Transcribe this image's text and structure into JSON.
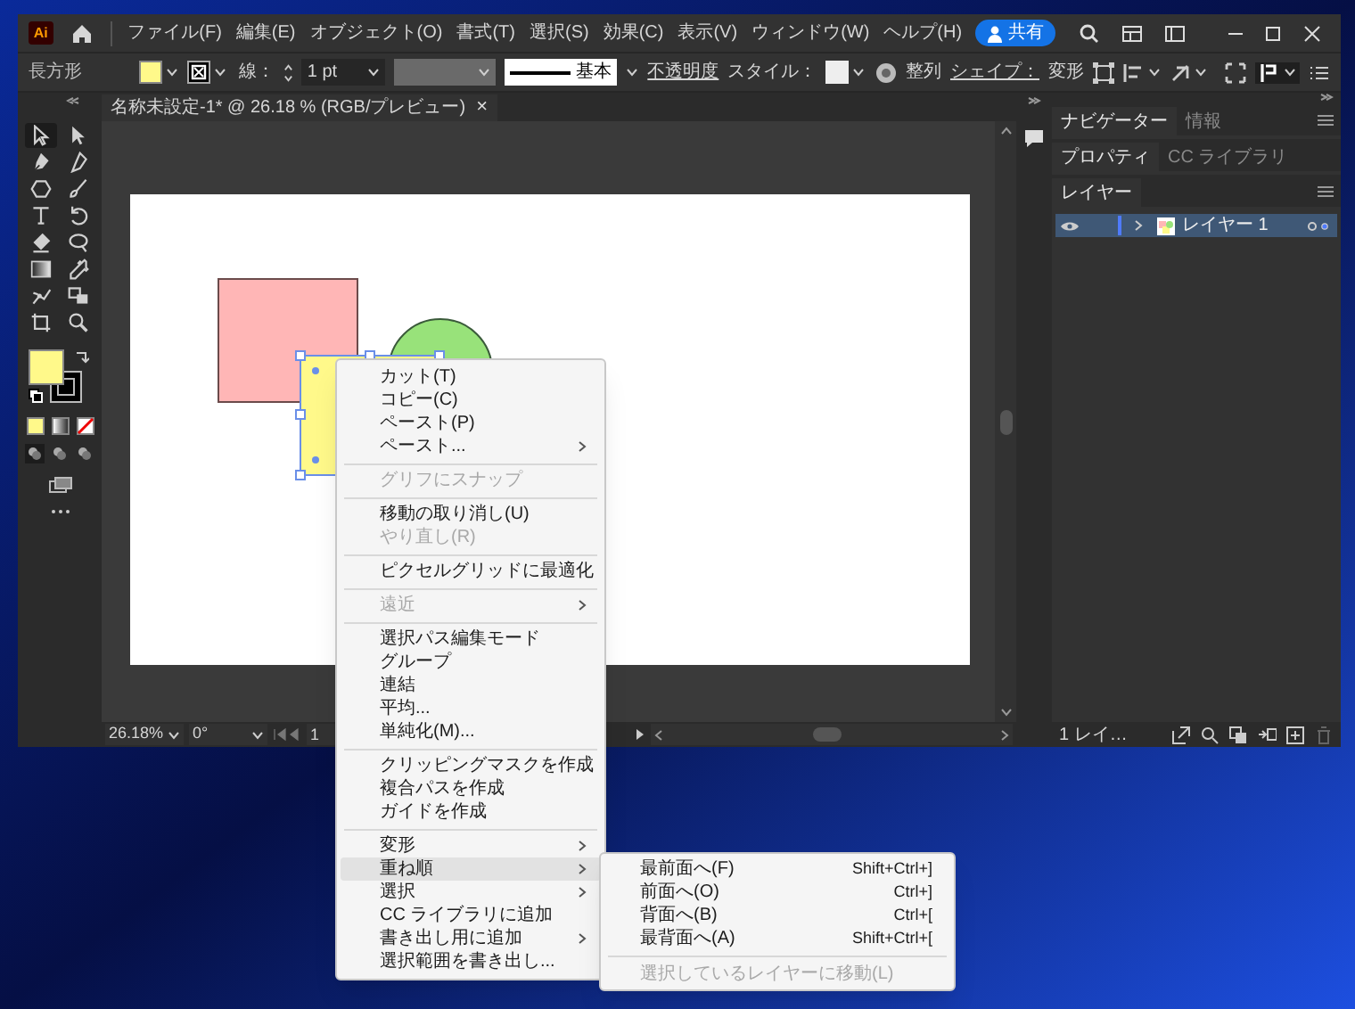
{
  "app": {
    "logo": "Ai"
  },
  "menu_bar": [
    "ファイル(F)",
    "編集(E)",
    "オブジェクト(O)",
    "書式(T)",
    "選択(S)",
    "効果(C)",
    "表示(V)",
    "ウィンドウ(W)",
    "ヘルプ(H)"
  ],
  "share_button": {
    "label": "共有"
  },
  "control_bar": {
    "object_type": "長方形",
    "stroke_label": "線：",
    "stroke_weight": "1 pt",
    "brush": "基本",
    "opacity_link": "不透明度",
    "style_label": "スタイル：",
    "align": "整列",
    "shape_label": "シェイプ：",
    "transform": "変形"
  },
  "tools": [
    {
      "selected": true
    },
    {
      "selected": false
    },
    {
      "selected": false
    },
    {
      "selected": false
    },
    {
      "selected": false
    },
    {
      "selected": false
    },
    {
      "selected": false
    },
    {
      "selected": false
    },
    {
      "selected": false
    },
    {
      "selected": false
    },
    {
      "selected": false
    },
    {
      "selected": false
    },
    {
      "selected": false
    },
    {
      "selected": false
    },
    {
      "selected": false
    },
    {
      "selected": false
    }
  ],
  "document_tab": {
    "title": "名称未設定-1* @ 26.18 % (RGB/プレビュー)",
    "close": "×"
  },
  "status_bar": {
    "zoom": "26.18%",
    "rotation": "0°",
    "artboard": "1"
  },
  "panels": {
    "tab_groups": [
      {
        "tabs": [
          {
            "label": "ナビゲーター",
            "selected": true
          },
          {
            "label": "情報",
            "selected": false
          }
        ]
      },
      {
        "tabs": [
          {
            "label": "プロパティ",
            "selected": true
          },
          {
            "label": "CC ライブラリ",
            "selected": false
          }
        ]
      },
      {
        "tabs": [
          {
            "label": "レイヤー",
            "selected": true
          }
        ]
      }
    ],
    "layers": [
      {
        "name": "レイヤー 1",
        "selected": true,
        "visible": true,
        "color": "#4f7bff"
      }
    ],
    "layer_count": "1 レイ…"
  },
  "context_menu": {
    "items": [
      {
        "kind": "item",
        "label": "カット(T)",
        "disabled": false,
        "submenu": false,
        "selected": false
      },
      {
        "kind": "item",
        "label": "コピー(C)",
        "disabled": false,
        "submenu": false,
        "selected": false
      },
      {
        "kind": "item",
        "label": "ペースト(P)",
        "disabled": false,
        "submenu": false,
        "selected": false
      },
      {
        "kind": "item",
        "label": "ペースト...",
        "disabled": false,
        "submenu": true,
        "selected": false
      },
      {
        "kind": "separator"
      },
      {
        "kind": "item",
        "label": "グリフにスナップ",
        "disabled": true,
        "submenu": false,
        "selected": false
      },
      {
        "kind": "separator"
      },
      {
        "kind": "item",
        "label": "移動の取り消し(U)",
        "disabled": false,
        "submenu": false,
        "selected": false
      },
      {
        "kind": "item",
        "label": "やり直し(R)",
        "disabled": true,
        "submenu": false,
        "selected": false
      },
      {
        "kind": "separator"
      },
      {
        "kind": "item",
        "label": "ピクセルグリッドに最適化",
        "disabled": false,
        "submenu": false,
        "selected": false
      },
      {
        "kind": "separator"
      },
      {
        "kind": "item",
        "label": "遠近",
        "disabled": true,
        "submenu": true,
        "selected": false
      },
      {
        "kind": "separator"
      },
      {
        "kind": "item",
        "label": "選択パス編集モード",
        "disabled": false,
        "submenu": false,
        "selected": false
      },
      {
        "kind": "item",
        "label": "グループ",
        "disabled": false,
        "submenu": false,
        "selected": false
      },
      {
        "kind": "item",
        "label": "連結",
        "disabled": false,
        "submenu": false,
        "selected": false
      },
      {
        "kind": "item",
        "label": "平均...",
        "disabled": false,
        "submenu": false,
        "selected": false
      },
      {
        "kind": "item",
        "label": "単純化(M)...",
        "disabled": false,
        "submenu": false,
        "selected": false
      },
      {
        "kind": "separator"
      },
      {
        "kind": "item",
        "label": "クリッピングマスクを作成",
        "disabled": false,
        "submenu": false,
        "selected": false
      },
      {
        "kind": "item",
        "label": "複合パスを作成",
        "disabled": false,
        "submenu": false,
        "selected": false
      },
      {
        "kind": "item",
        "label": "ガイドを作成",
        "disabled": false,
        "submenu": false,
        "selected": false
      },
      {
        "kind": "separator"
      },
      {
        "kind": "item",
        "label": "変形",
        "disabled": false,
        "submenu": true,
        "selected": false
      },
      {
        "kind": "item",
        "label": "重ね順",
        "disabled": false,
        "submenu": true,
        "selected": true
      },
      {
        "kind": "item",
        "label": "選択",
        "disabled": false,
        "submenu": true,
        "selected": false
      },
      {
        "kind": "item",
        "label": "CC ライブラリに追加",
        "disabled": false,
        "submenu": false,
        "selected": false
      },
      {
        "kind": "item",
        "label": "書き出し用に追加",
        "disabled": false,
        "submenu": true,
        "selected": false
      },
      {
        "kind": "item",
        "label": "選択範囲を書き出し...",
        "disabled": false,
        "submenu": false,
        "selected": false
      }
    ]
  },
  "submenu": {
    "items": [
      {
        "kind": "item",
        "label": "最前面へ(F)",
        "shortcut": "Shift+Ctrl+]",
        "disabled": false
      },
      {
        "kind": "item",
        "label": "前面へ(O)",
        "shortcut": "Ctrl+]",
        "disabled": false
      },
      {
        "kind": "item",
        "label": "背面へ(B)",
        "shortcut": "Ctrl+[",
        "disabled": false
      },
      {
        "kind": "item",
        "label": "最背面へ(A)",
        "shortcut": "Shift+Ctrl+[",
        "disabled": false
      },
      {
        "kind": "separator"
      },
      {
        "kind": "item",
        "label": "選択しているレイヤーに移動(L)",
        "disabled": true
      }
    ]
  }
}
